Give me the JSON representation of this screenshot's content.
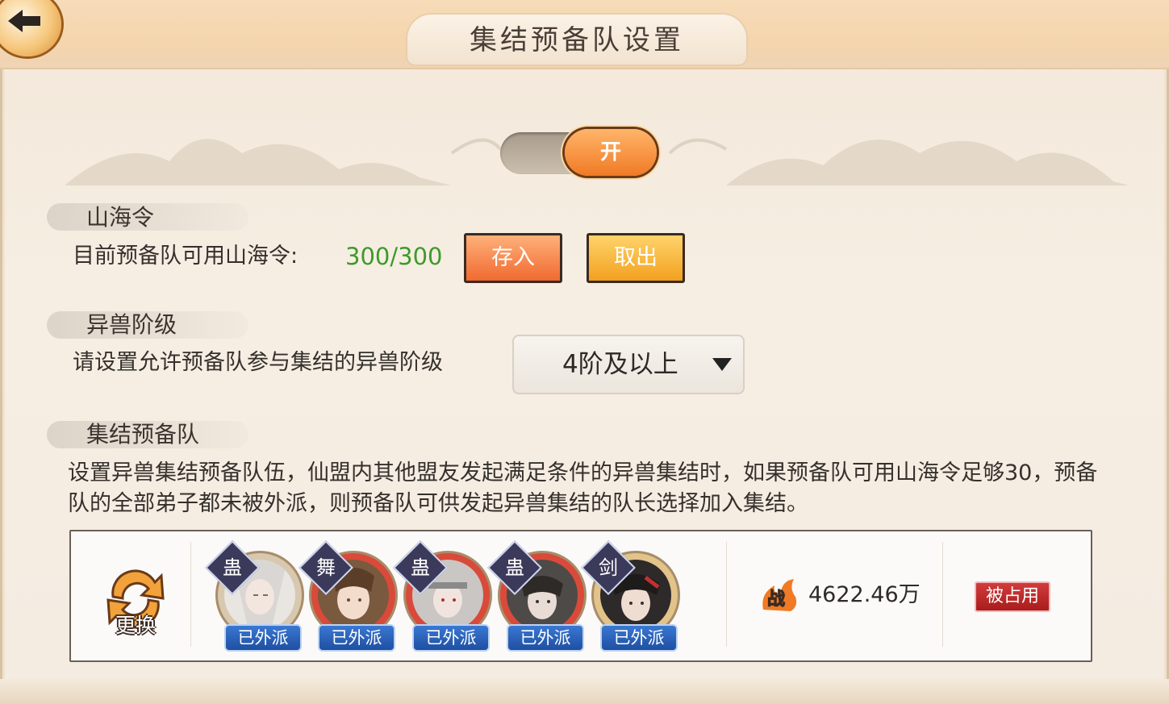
{
  "title": "集结预备队设置",
  "toggle": {
    "label": "开",
    "on": true
  },
  "shanhai": {
    "heading": "山海令",
    "label": "目前预备队可用山海令:",
    "value": "300/300",
    "deposit_label": "存入",
    "withdraw_label": "取出"
  },
  "beast_level": {
    "heading": "异兽阶级",
    "label": "请设置允许预备队参与集结的异兽阶级",
    "selected": "4阶及以上"
  },
  "reserve": {
    "heading": "集结预备队",
    "description": "设置异兽集结预备队伍，仙盟内其他盟友发起满足条件的异兽集结时，如果预备队可用山海令足够30，预备队的全部弟子都未被外派，则预备队可供发起异兽集结的队长选择加入集结。"
  },
  "team": {
    "swap_label": "更换",
    "heroes": [
      {
        "class": "蛊",
        "status": "已外派",
        "ring": "#d8c8b0"
      },
      {
        "class": "舞",
        "status": "已外派",
        "ring": "#d94a3a"
      },
      {
        "class": "蛊",
        "status": "已外派",
        "ring": "#d94a3a"
      },
      {
        "class": "蛊",
        "status": "已外派",
        "ring": "#d94a3a"
      },
      {
        "class": "剑",
        "status": "已外派",
        "ring": "#e2c48a"
      }
    ],
    "power_icon_label": "战",
    "power_value": "4622.46万",
    "occupied_label": "被占用"
  }
}
